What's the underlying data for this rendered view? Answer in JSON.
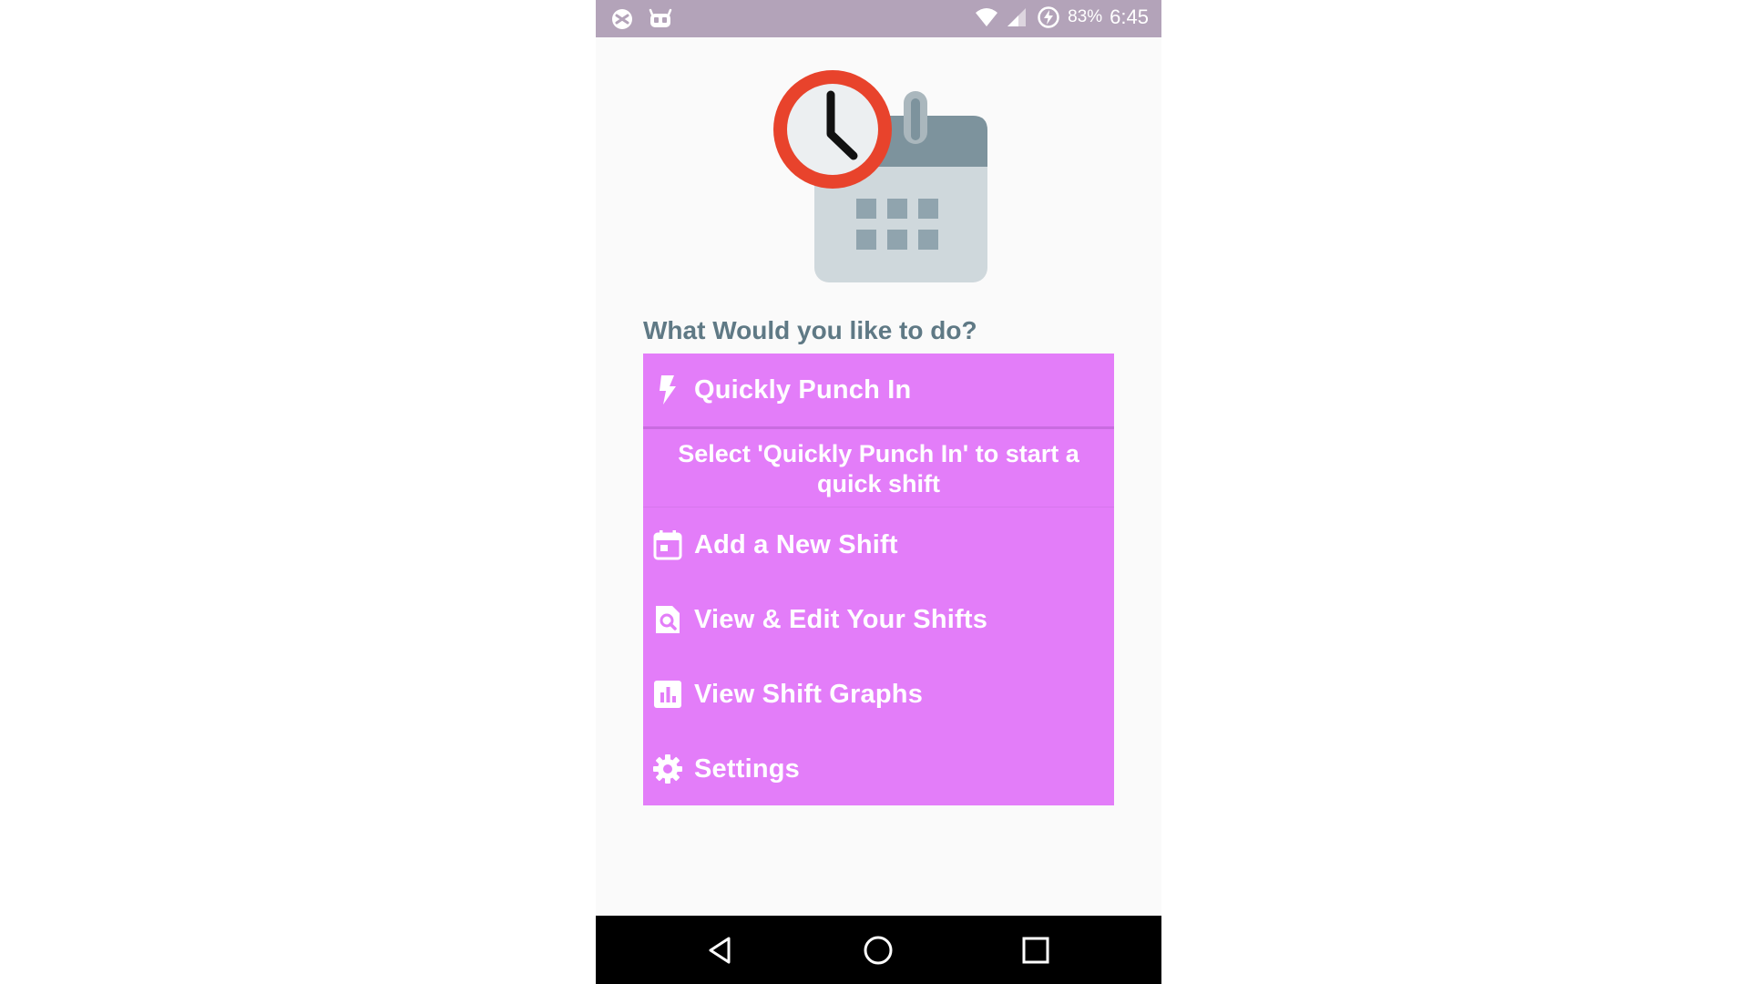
{
  "status_bar": {
    "battery_percent": "83%",
    "time": "6:45",
    "background": "#b3a3b9"
  },
  "main": {
    "question": "What Would you like to do?",
    "accent_color": "#e37df9",
    "quick_punch": {
      "label": "Quickly Punch In",
      "icon": "lightning-bolt-icon"
    },
    "hint": "Select 'Quickly Punch In' to start a quick shift",
    "menu_items": [
      {
        "label": "Add a New Shift",
        "icon": "calendar-icon"
      },
      {
        "label": "View & Edit Your Shifts",
        "icon": "document-search-icon"
      },
      {
        "label": "View Shift Graphs",
        "icon": "bar-chart-icon"
      },
      {
        "label": "Settings",
        "icon": "gear-icon"
      }
    ]
  },
  "nav_bar": {
    "back": "back-triangle-icon",
    "home": "home-circle-icon",
    "recents": "recents-square-icon"
  }
}
